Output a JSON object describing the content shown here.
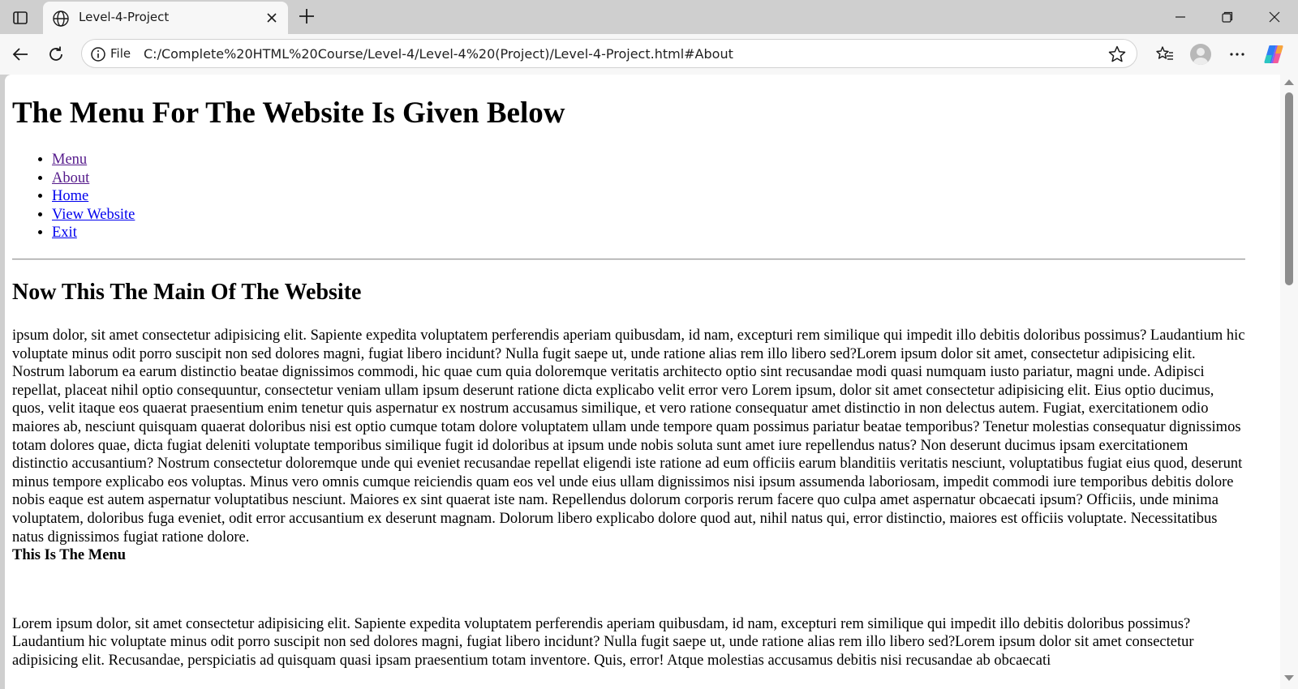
{
  "browser": {
    "tab_title": "Level-4-Project",
    "file_label": "File",
    "url": "C:/Complete%20HTML%20Course/Level-4/Level-4%20(Project)/Level-4-Project.html#About",
    "icons": [
      "tab-actions-icon",
      "globe-icon",
      "close-icon",
      "plus-icon",
      "minimize-icon",
      "restore-icon",
      "window-close-icon",
      "back-icon",
      "reload-icon",
      "info-icon",
      "star-icon",
      "favorites-icon",
      "avatar-icon",
      "more-icon",
      "copilot-icon"
    ],
    "accent_color": "#0000ee"
  },
  "page": {
    "heading": "The Menu For The Website Is Given Below",
    "menu": [
      {
        "label": "Menu",
        "visited": true
      },
      {
        "label": "About",
        "visited": true
      },
      {
        "label": "Home",
        "visited": false
      },
      {
        "label": "View Website",
        "visited": false
      },
      {
        "label": "Exit",
        "visited": false
      }
    ],
    "main_heading": "Now This The Main Of The Website",
    "paragraph1": "ipsum dolor, sit amet consectetur adipisicing elit. Sapiente expedita voluptatem perferendis aperiam quibusdam, id nam, excepturi rem similique qui impedit illo debitis doloribus possimus? Laudantium hic voluptate minus odit porro suscipit non sed dolores magni, fugiat libero incidunt? Nulla fugit saepe ut, unde ratione alias rem illo libero sed?Lorem ipsum dolor sit amet, consectetur adipisicing elit. Nostrum laborum ea earum distinctio beatae dignissimos commodi, hic quae cum quia doloremque veritatis architecto optio sint recusandae modi quasi numquam iusto pariatur, magni unde. Adipisci repellat, placeat nihil optio consequuntur, consectetur veniam ullam ipsum deserunt ratione dicta explicabo velit error vero Lorem ipsum, dolor sit amet consectetur adipisicing elit. Eius optio ducimus, quos, velit itaque eos quaerat praesentium enim tenetur quis aspernatur ex nostrum accusamus similique, et vero ratione consequatur amet distinctio in non delectus autem. Fugiat, exercitationem odio maiores ab, nesciunt quisquam quaerat doloribus nisi est optio cumque totam dolore voluptatem ullam unde tempore quam possimus pariatur beatae temporibus? Tenetur molestias consequatur dignissimos totam dolores quae, dicta fugiat deleniti voluptate temporibus similique fugit id doloribus at ipsum unde nobis soluta sunt amet iure repellendus natus? Non deserunt ducimus ipsam exercitationem distinctio accusantium? Nostrum consectetur doloremque unde qui eveniet recusandae repellat eligendi iste ratione ad eum officiis earum blanditiis veritatis nesciunt, voluptatibus fugiat eius quod, deserunt minus tempore explicabo eos voluptas. Minus vero omnis cumque reiciendis quam eos vel unde eius ullam dignissimos nisi ipsum assumenda laboriosam, impedit commodi iure temporibus debitis dolore nobis eaque est autem aspernatur voluptatibus nesciunt. Maiores ex sint quaerat iste nam. Repellendus dolorum corporis rerum facere quo culpa amet aspernatur obcaecati ipsum? Officiis, unde minima voluptatem, doloribus fuga eveniet, odit error accusantium ex deserunt magnam. Dolorum libero explicabo dolore quod aut, nihil natus qui, error distinctio, maiores est officiis voluptate. Necessitatibus natus dignissimos fugiat ratione dolore.",
    "menu_label": "This Is The Menu",
    "paragraph2": "Lorem ipsum dolor, sit amet consectetur adipisicing elit. Sapiente expedita voluptatem perferendis aperiam quibusdam, id nam, excepturi rem similique qui impedit illo debitis doloribus possimus? Laudantium hic voluptate minus odit porro suscipit non sed dolores magni, fugiat libero incidunt? Nulla fugit saepe ut, unde ratione alias rem illo libero sed?Lorem ipsum dolor sit amet consectetur adipisicing elit. Recusandae, perspiciatis ad quisquam quasi ipsam praesentium totam inventore. Quis, error! Atque molestias accusamus debitis nisi recusandae ab obcaecati"
  }
}
